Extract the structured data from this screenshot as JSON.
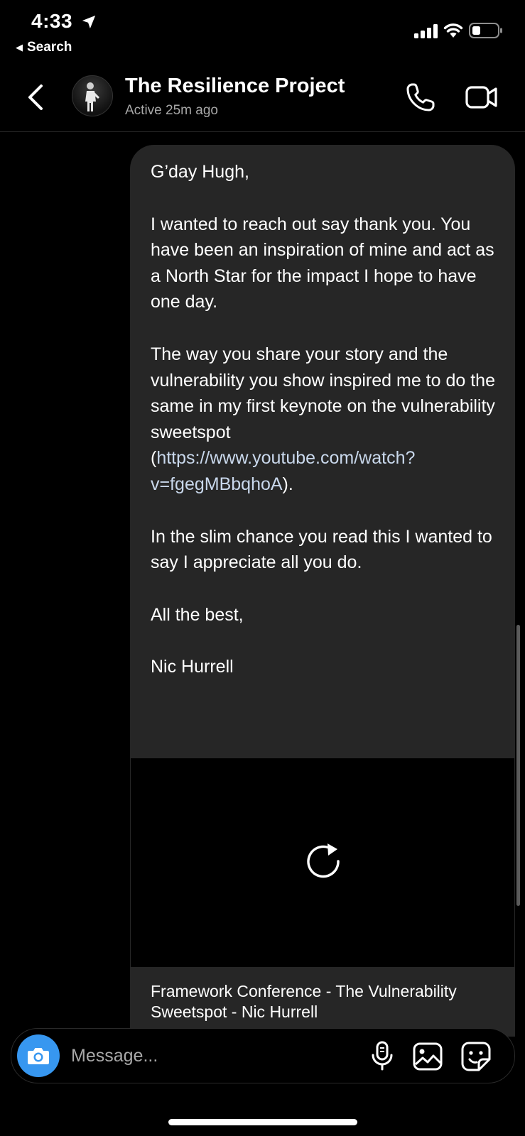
{
  "status_bar": {
    "time": "4:33",
    "back_app_label": "Search",
    "back_triangle": "◀",
    "icons": [
      "location-arrow-icon",
      "signal-icon",
      "wifi-icon",
      "battery-icon"
    ]
  },
  "header": {
    "contact_name": "The Resilience Project",
    "status": "Active 25m ago",
    "icons": [
      "back-chevron-icon",
      "phone-icon",
      "video-camera-icon"
    ]
  },
  "message": {
    "greeting": "G’day Hugh,",
    "para1": "I wanted to reach out say thank you. You have been an inspiration of mine and act as a North Star for the impact I hope to have one day.",
    "para2_text": "The way you share your story and the vulnerability you show inspired me to do the same in my first keynote on the vulnerability sweetspot (",
    "para2_link": "https://www.youtube.com/watch?v=fgegMBbqhoA",
    "para2_end": ").",
    "para3": "In the slim chance you read this I wanted to say I appreciate all you do.",
    "signoff": "All the best,",
    "signature": "Nic Hurrell",
    "video_caption": "Framework Conference - The Vulnerability Sweetspot - Nic Hurrell",
    "video_icon": "replay-icon"
  },
  "composer": {
    "placeholder": "Message...",
    "icons": [
      "camera-icon",
      "microphone-icon",
      "gallery-icon",
      "sticker-icon"
    ]
  },
  "colors": {
    "background": "#000000",
    "bubble": "#262626",
    "accent": "#3797f0",
    "link": "#c9d8ec",
    "muted_text": "#a8a8a8"
  }
}
